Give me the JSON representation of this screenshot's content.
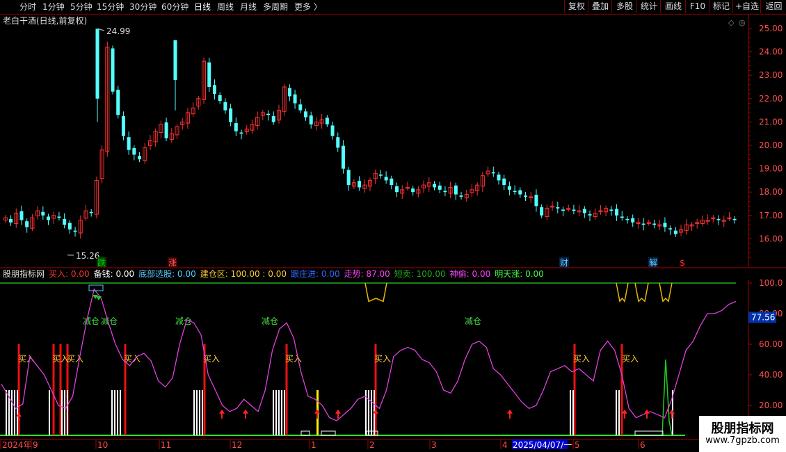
{
  "toolbar": {
    "periods": [
      {
        "label": "分时",
        "active": false
      },
      {
        "label": "1分钟",
        "active": false
      },
      {
        "label": "5分钟",
        "active": false
      },
      {
        "label": "15分钟",
        "active": false
      },
      {
        "label": "30分钟",
        "active": false
      },
      {
        "label": "60分钟",
        "active": false
      },
      {
        "label": "日线",
        "active": true
      },
      {
        "label": "周线",
        "active": false
      },
      {
        "label": "月线",
        "active": false
      },
      {
        "label": "多周期",
        "active": false
      },
      {
        "label": "更多 〉",
        "active": false
      }
    ],
    "actions": [
      "复权",
      "叠加",
      "多股",
      "统计",
      "画线",
      "F10",
      "标记",
      "+自选",
      "返回"
    ]
  },
  "price_title": "老白干酒(日线,前复权)",
  "price_panel": {
    "right_axis": [
      "25.00",
      "24.00",
      "23.00",
      "22.00",
      "21.00",
      "20.00",
      "19.00",
      "18.00",
      "17.00",
      "16.00"
    ],
    "high_label": "24.99",
    "low_label": "15.26",
    "event_markers": [
      {
        "text": "跌",
        "color": "#00cc00",
        "bg": "#004400"
      },
      {
        "text": "涨",
        "color": "#ff6666",
        "bg": "#440000"
      },
      {
        "text": "财",
        "color": "#66ccff",
        "bg": "#002244"
      },
      {
        "text": "解",
        "color": "#66ccff",
        "bg": "#002244"
      },
      {
        "text": "$",
        "color": "#ff3333",
        "bg": "#000000"
      }
    ],
    "colors": {
      "up": "#ff3232",
      "down": "#54ffff"
    }
  },
  "indicator_header": [
    {
      "text": "股朋指标网",
      "color": "#dddddd"
    },
    {
      "text": "买入: 0.00",
      "color": "#ff3333"
    },
    {
      "text": "备钱: 0.00",
      "color": "#ffffff"
    },
    {
      "text": "底部选股: 0.00",
      "color": "#55ccff"
    },
    {
      "text": "建仓区: 100.00 : 0.00",
      "color": "#ffcc33"
    },
    {
      "text": "跟庄进: 0.00",
      "color": "#3366ff"
    },
    {
      "text": "走势: 87.00",
      "color": "#ff44ff"
    },
    {
      "text": "短卖: 100.00",
      "color": "#22aa22"
    },
    {
      "text": "神偷: 0.00",
      "color": "#ff44ff"
    },
    {
      "text": "明天涨: 0.00",
      "color": "#44ff44"
    }
  ],
  "indicator_panel": {
    "right_axis": [
      "100.0",
      "80.00",
      "60.00",
      "40.00",
      "20.00"
    ],
    "current_value": "77.56",
    "buy_label": "买入",
    "reduce_label": "减仓"
  },
  "x_axis": {
    "labels": [
      "2024年",
      "9",
      "10",
      "11",
      "12",
      "1",
      "2",
      "3",
      "4",
      "2025/04/07/一",
      "5",
      "6"
    ]
  },
  "watermark": {
    "title": "股朋指标网",
    "url": "www.7gpzb.com"
  },
  "chart_data": {
    "type": "candlestick",
    "note_units": "price in CNY",
    "closes_sampled": [
      16.9,
      16.7,
      17.1,
      16.8,
      16.5,
      16.9,
      17.2,
      17.0,
      16.8,
      17.0,
      16.9,
      16.6,
      16.4,
      16.3,
      16.8,
      17.2,
      17.1,
      18.5,
      19.8,
      24.2,
      22.3,
      21.3,
      20.4,
      19.8,
      19.6,
      19.4,
      19.9,
      20.2,
      20.6,
      20.9,
      20.3,
      20.5,
      20.8,
      21.0,
      21.4,
      21.6,
      22.0,
      23.6,
      22.5,
      22.2,
      21.9,
      21.5,
      21.0,
      20.6,
      20.5,
      20.7,
      20.9,
      21.2,
      21.4,
      21.3,
      21.0,
      21.5,
      22.5,
      22.1,
      21.8,
      21.5,
      21.2,
      20.9,
      21.0,
      21.1,
      20.9,
      20.4,
      19.9,
      19.0,
      18.3,
      18.4,
      18.2,
      18.3,
      18.5,
      18.8,
      18.7,
      18.5,
      18.3,
      18.0,
      18.1,
      18.2,
      18.0,
      18.1,
      18.3,
      18.4,
      18.2,
      18.1,
      18.0,
      18.2,
      17.9,
      17.8,
      17.9,
      18.1,
      18.3,
      18.7,
      18.9,
      18.8,
      18.5,
      18.3,
      18.1,
      18.0,
      17.9,
      17.8,
      17.8,
      17.4,
      17.0,
      17.3,
      17.4,
      17.3,
      17.2,
      17.3,
      17.2,
      17.2,
      17.1,
      17.0,
      17.1,
      17.2,
      17.3,
      17.2,
      17.0,
      16.9,
      16.8,
      16.7,
      16.7,
      16.6,
      16.7,
      16.6,
      16.6,
      16.5,
      16.4,
      16.2,
      16.4,
      16.6,
      16.6,
      16.7,
      16.8,
      16.8,
      16.9,
      16.8,
      16.8,
      16.9,
      16.8
    ],
    "indicator_trend_sampled": [
      34,
      26,
      18,
      21,
      52,
      46,
      40,
      30,
      20,
      18,
      26,
      52,
      76,
      96,
      90,
      74,
      60,
      50,
      46,
      52,
      54,
      49,
      36,
      32,
      38,
      60,
      76,
      74,
      66,
      40,
      30,
      20,
      16,
      18,
      24,
      20,
      16,
      30,
      56,
      70,
      74,
      64,
      42,
      26,
      24,
      20,
      12,
      10,
      14,
      18,
      24,
      26,
      22,
      18,
      30,
      52,
      56,
      58,
      56,
      50,
      48,
      42,
      30,
      28,
      36,
      50,
      60,
      62,
      58,
      44,
      40,
      34,
      28,
      22,
      18,
      20,
      30,
      42,
      44,
      46,
      42,
      44,
      40,
      36,
      56,
      62,
      56,
      40,
      18,
      12,
      14,
      16,
      14,
      12,
      24,
      40,
      56,
      62,
      72,
      80,
      80,
      82,
      86,
      88
    ],
    "price_ylim": [
      15.2,
      25.2
    ],
    "indicator_ylim": [
      0,
      105
    ]
  }
}
